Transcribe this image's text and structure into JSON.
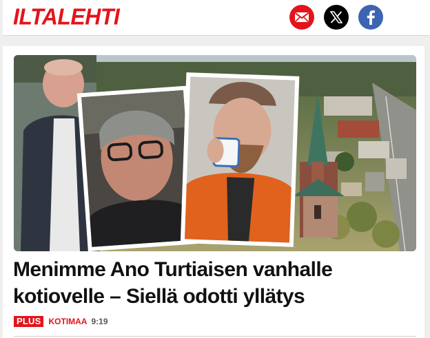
{
  "header": {
    "logo": "ILTALEHTI",
    "share": {
      "email_icon": "envelope-icon",
      "x_icon": "x-logo-icon",
      "facebook_icon": "facebook-f-icon"
    }
  },
  "article": {
    "headline": "Menimme Ano Turtiaisen vanhalle kotiovelle – Siellä odotti yllätys",
    "badge": "PLUS",
    "section": "KOTIMAA",
    "time": "9:19"
  },
  "colors": {
    "brand_red": "#e3141b",
    "facebook_blue": "#3c64b1",
    "x_black": "#000000"
  }
}
